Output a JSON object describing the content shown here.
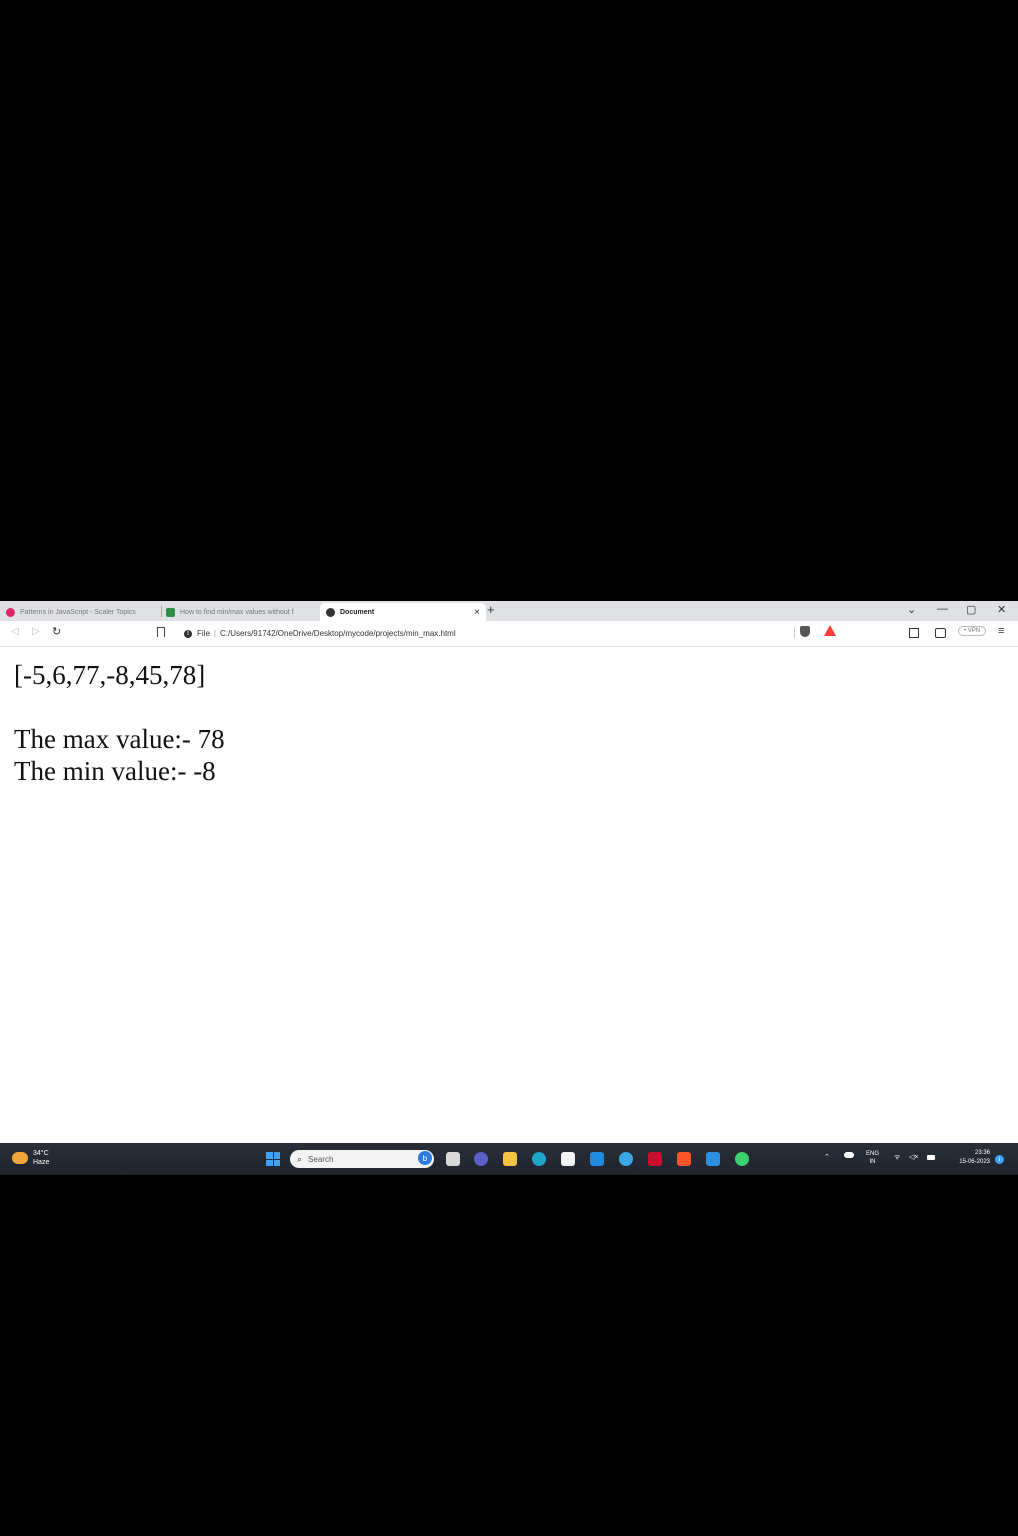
{
  "browser": {
    "tabs": [
      {
        "label": "Patterns in JavaScript - Scaler Topics",
        "favicon_color": "#e0246a"
      },
      {
        "label": "How to find min/max values without f",
        "favicon_color": "#2f8d46"
      },
      {
        "label": "Document",
        "favicon_color": "#333333",
        "active": true
      }
    ],
    "new_tab_symbol": "+",
    "close_tab_symbol": "×",
    "window_controls": {
      "dropdown": "⌄",
      "minimize": "—",
      "maximize": "▢",
      "close": "✕"
    },
    "url": {
      "scheme_label": "File",
      "path": "C:/Users/91742/OneDrive/Desktop/mycode/projects/min_max.html"
    },
    "vpn_label": "• VPN",
    "menu_symbol": "≡"
  },
  "page": {
    "array_text": "[-5,6,77,-8,45,78]",
    "max_text": "The max value:- 78",
    "min_text": "The min value:- -8"
  },
  "taskbar": {
    "weather_temp": "34°C",
    "weather_desc": "Haze",
    "search_placeholder": "Search",
    "bing_letter": "b",
    "lang_top": "ENG",
    "lang_bottom": "IN",
    "time": "23:36",
    "date": "15-06-2023",
    "apps": [
      {
        "name": "file-manager",
        "color": "#d8d8d8"
      },
      {
        "name": "teams",
        "color": "#5b5fc7"
      },
      {
        "name": "file-explorer",
        "color": "#f5c242"
      },
      {
        "name": "edge",
        "color": "#1fa3c9"
      },
      {
        "name": "store",
        "color": "#f4f4f4"
      },
      {
        "name": "mail",
        "color": "#1f8be0"
      },
      {
        "name": "whiteboard",
        "color": "#3aa7e8"
      },
      {
        "name": "mcafee",
        "color": "#c8102e"
      },
      {
        "name": "brave",
        "color": "#fb542b"
      },
      {
        "name": "vscode",
        "color": "#2a8fe0"
      },
      {
        "name": "whatsapp",
        "color": "#3bd16f"
      }
    ]
  }
}
